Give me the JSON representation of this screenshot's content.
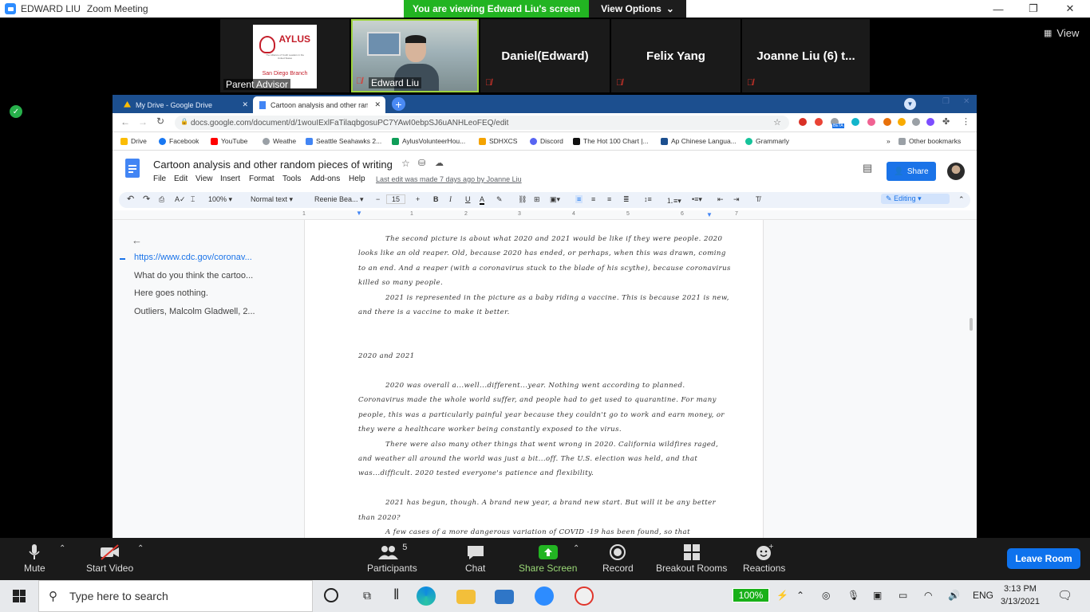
{
  "zoom": {
    "window_title_user": "EDWARD LIU",
    "window_title_app": "Zoom Meeting",
    "viewing_banner": "You are viewing Edward Liu's screen",
    "view_options": "View Options",
    "view_button": "View",
    "participants_tiles": [
      {
        "label": "Parent Advisor",
        "type": "logo",
        "logo_text": "AYLUS",
        "logo_sub": "The Alliance of Youth Leaders in the United States",
        "logo_tag": "San Diego Branch"
      },
      {
        "label": "Edward Liu",
        "type": "video"
      },
      {
        "label": "Daniel(Edward)",
        "type": "name"
      },
      {
        "label": "Felix Yang",
        "type": "name"
      },
      {
        "label": "Joanne Liu (6) t...",
        "type": "name"
      }
    ],
    "bottom": {
      "mute": "Mute",
      "start_video": "Start Video",
      "participants": "Participants",
      "participants_count": "5",
      "chat": "Chat",
      "share_screen": "Share Screen",
      "record": "Record",
      "breakout_rooms": "Breakout Rooms",
      "reactions": "Reactions",
      "leave_room": "Leave Room"
    }
  },
  "browser": {
    "tabs": [
      {
        "title": "My Drive - Google Drive",
        "active": false
      },
      {
        "title": "Cartoon analysis and other rando",
        "active": true
      }
    ],
    "url": "docs.google.com/document/d/1wouIExlFaTilaqbgosuPC7YAwI0ebpSJ6uANHLeoFEQ/edit",
    "bookmarks": [
      "Drive",
      "Facebook",
      "YouTube",
      "Weathe",
      "Seattle Seahawks 2...",
      "AylusVolunteerHou...",
      "SDHXCS",
      "Discord",
      "The Hot 100 Chart |...",
      "Ap Chinese Langua...",
      "Grammarly"
    ],
    "bookmarks_more": "»",
    "other_bookmarks": "Other bookmarks",
    "ext_beta": "BETA"
  },
  "doc": {
    "title": "Cartoon analysis and other random pieces of writing",
    "menus": [
      "File",
      "Edit",
      "View",
      "Insert",
      "Format",
      "Tools",
      "Add-ons",
      "Help"
    ],
    "last_edit": "Last edit was made 7 days ago by Joanne Liu",
    "share": "Share",
    "toolbar": {
      "zoom": "100%",
      "style": "Normal text",
      "font": "Reenie Bea...",
      "size": "15",
      "mode": "Editing"
    },
    "ruler_marks": [
      "1",
      "1",
      "2",
      "3",
      "4",
      "5",
      "6",
      "7"
    ],
    "outline": [
      "https://www.cdc.gov/coronav...",
      "What do you think the cartoo...",
      "Here goes nothing.",
      "Outliers, Malcolm Gladwell, 2..."
    ],
    "paragraphs": [
      "The second picture is about what 2020 and 2021 would be like if they were people. 2020 looks like an old reaper. Old, because 2020 has ended, or perhaps, when this was drawn, coming to an end. And a reaper (with a coronavirus stuck to the blade of his scythe), because coronavirus killed so many people.",
      "2021 is represented in the picture as a baby riding a vaccine. This is because 2021 is new, and there is a vaccine to make it better.",
      "2020 and 2021",
      "2020 was overall a...well...different...year. Nothing went according to planned. Coronavirus made the whole world suffer, and people had to get used to quarantine. For many people, this was a particularly painful year because they couldn't go to work and earn money, or they were a healthcare worker being constantly exposed to the virus.",
      "There were also many other things that went wrong in 2020. California wildfires raged, and weather all around the world was just a bit...off. The U.S. election was held, and that was...difficult. 2020 tested everyone's patience and flexibility.",
      "2021 has begun, though. A brand new year, a brand new start. But will it be any better than 2020?",
      "A few cases of a more dangerous variation of COVID -19 has been found, so that"
    ]
  },
  "taskbar": {
    "search_placeholder": "Type here to search",
    "battery": "100%",
    "lang": "ENG",
    "time": "3:13 PM",
    "date": "3/13/2021"
  },
  "colors": {
    "zoom_green": "#22b422",
    "zoom_blue": "#0e72ed",
    "docs_blue": "#1a73e8",
    "mute_red": "#e0352b"
  }
}
